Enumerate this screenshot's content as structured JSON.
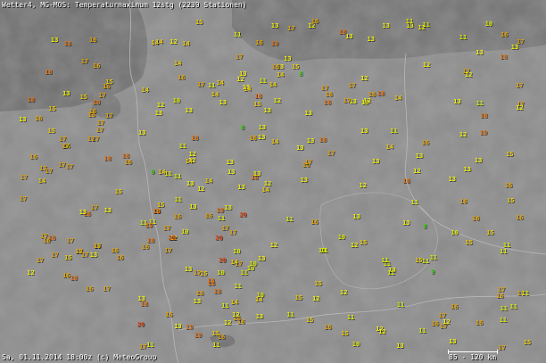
{
  "header": {
    "title": "Wetter4, MG-MOS: Temperaturmaximum 12stg (2239 Stationen)"
  },
  "footer": {
    "timestamp": "Sa, 01.11.2014 18:00z (c) MeteoGroup",
    "scale": "85 - 120 km"
  },
  "colors": {
    "background": "#818181",
    "land": "#8c8c8c",
    "sea": "#6f6f6f",
    "border": "#b8b8b8",
    "temp_10_11": "#d8e800",
    "temp_12_13": "#f0f000",
    "temp_14_15": "#e8c800",
    "temp_16_17": "#e0a000",
    "temp_18_19": "#e07010",
    "temp_20_plus": "#d84818",
    "cool_8_9": "#40d020"
  },
  "stations": [
    {
      "v": "16"
    },
    {
      "v": "16"
    },
    {
      "v": "17"
    },
    {
      "v": "17"
    },
    {
      "v": "15"
    },
    {
      "v": "17"
    },
    {
      "v": "16"
    },
    {
      "v": "15"
    },
    {
      "v": "17"
    },
    {
      "v": "16"
    },
    {
      "v": "16"
    },
    {
      "v": "17"
    },
    {
      "v": "15"
    },
    {
      "v": "16"
    },
    {
      "v": "14"
    },
    {
      "v": "15"
    },
    {
      "v": "16"
    },
    {
      "v": "17"
    },
    {
      "v": "18"
    },
    {
      "v": "17"
    },
    {
      "v": "15"
    },
    {
      "v": "17"
    },
    {
      "v": "15"
    },
    {
      "v": "16"
    },
    {
      "v": "17"
    },
    {
      "v": "17"
    },
    {
      "v": "18"
    },
    {
      "v": "17"
    },
    {
      "v": "16"
    },
    {
      "v": "18"
    },
    {
      "v": "18"
    },
    {
      "v": "16"
    },
    {
      "v": "15"
    },
    {
      "v": "13"
    },
    {
      "v": "18"
    },
    {
      "v": "17"
    },
    {
      "v": "18"
    },
    {
      "v": "17"
    },
    {
      "v": "17"
    },
    {
      "v": "16"
    },
    {
      "v": "18"
    },
    {
      "v": "17"
    },
    {
      "v": "15"
    },
    {
      "v": "17"
    },
    {
      "v": "17"
    },
    {
      "v": "13"
    },
    {
      "v": "18"
    },
    {
      "v": "16"
    },
    {
      "v": "14"
    },
    {
      "v": "13"
    },
    {
      "v": "13"
    },
    {
      "v": "12"
    },
    {
      "v": "18"
    },
    {
      "v": "17"
    },
    {
      "v": "17"
    },
    {
      "v": "16"
    },
    {
      "v": "17"
    },
    {
      "v": "13"
    },
    {
      "v": "17"
    },
    {
      "v": "17"
    },
    {
      "v": "17"
    },
    {
      "v": "13"
    },
    {
      "v": "17"
    },
    {
      "v": "16"
    },
    {
      "v": "15"
    },
    {
      "v": "18"
    },
    {
      "v": "16"
    },
    {
      "v": "17"
    },
    {
      "v": "18"
    },
    {
      "v": "18"
    },
    {
      "v": "17"
    },
    {
      "v": "16"
    },
    {
      "v": "13"
    },
    {
      "v": "13"
    },
    {
      "v": "13"
    },
    {
      "v": "14"
    },
    {
      "v": "13"
    },
    {
      "v": "14"
    },
    {
      "v": "15"
    },
    {
      "v": "13"
    },
    {
      "v": "14"
    },
    {
      "v": "14"
    },
    {
      "v": "14"
    },
    {
      "v": "11"
    },
    {
      "v": "10"
    },
    {
      "v": "8"
    },
    {
      "v": "9"
    },
    {
      "v": "12"
    },
    {
      "v": "14"
    },
    {
      "v": "13"
    },
    {
      "v": "11"
    },
    {
      "v": "12"
    },
    {
      "v": "13"
    },
    {
      "v": "13"
    },
    {
      "v": "13"
    },
    {
      "v": "14"
    },
    {
      "v": "13"
    },
    {
      "v": "12"
    },
    {
      "v": "14"
    },
    {
      "v": "13"
    },
    {
      "v": "12"
    },
    {
      "v": "14"
    },
    {
      "v": "13"
    },
    {
      "v": "13"
    },
    {
      "v": "14"
    },
    {
      "v": "15"
    },
    {
      "v": "14"
    },
    {
      "v": "14"
    },
    {
      "v": "12"
    },
    {
      "v": "11"
    },
    {
      "v": "11"
    },
    {
      "v": "13"
    },
    {
      "v": "14"
    },
    {
      "v": "12"
    },
    {
      "v": "13"
    },
    {
      "v": "12"
    },
    {
      "v": "8"
    },
    {
      "v": "11"
    },
    {
      "v": "13"
    },
    {
      "v": "13"
    },
    {
      "v": "14"
    },
    {
      "v": "12"
    },
    {
      "v": "13"
    },
    {
      "v": "12"
    },
    {
      "v": "11"
    },
    {
      "v": "13"
    },
    {
      "v": "13"
    },
    {
      "v": "14"
    },
    {
      "v": "17"
    },
    {
      "v": "16"
    },
    {
      "v": "17"
    },
    {
      "v": "16"
    },
    {
      "v": "17"
    },
    {
      "v": "17"
    },
    {
      "v": "16"
    },
    {
      "v": "15"
    },
    {
      "v": "15"
    },
    {
      "v": "16"
    },
    {
      "v": "16"
    },
    {
      "v": "16"
    },
    {
      "v": "17"
    },
    {
      "v": "18"
    },
    {
      "v": "16"
    },
    {
      "v": "18"
    },
    {
      "v": "14"
    },
    {
      "v": "17"
    },
    {
      "v": "16"
    },
    {
      "v": "17"
    },
    {
      "v": "16"
    },
    {
      "v": "13"
    },
    {
      "v": "14"
    },
    {
      "v": "13"
    },
    {
      "v": "15"
    },
    {
      "v": "11"
    },
    {
      "v": "12"
    },
    {
      "v": "11"
    },
    {
      "v": "11"
    },
    {
      "v": "11"
    },
    {
      "v": "11"
    },
    {
      "v": "11"
    },
    {
      "v": "13"
    },
    {
      "v": "12"
    },
    {
      "v": "10"
    },
    {
      "v": "11"
    },
    {
      "v": "10"
    },
    {
      "v": "10"
    },
    {
      "v": "10"
    },
    {
      "v": "13"
    },
    {
      "v": "11"
    },
    {
      "v": "13"
    },
    {
      "v": "13"
    },
    {
      "v": "10"
    },
    {
      "v": "11"
    },
    {
      "v": "12"
    },
    {
      "v": "10"
    },
    {
      "v": "13"
    },
    {
      "v": "20"
    },
    {
      "v": "19"
    },
    {
      "v": "20"
    },
    {
      "v": "19"
    },
    {
      "v": "18"
    },
    {
      "v": "19"
    },
    {
      "v": "20"
    },
    {
      "v": "19"
    },
    {
      "v": "18"
    },
    {
      "v": "20"
    },
    {
      "v": "19"
    },
    {
      "v": "18"
    },
    {
      "v": "20"
    },
    {
      "v": "19"
    },
    {
      "v": "18"
    },
    {
      "v": "19"
    },
    {
      "v": "18"
    },
    {
      "v": "17"
    },
    {
      "v": "16"
    },
    {
      "v": "17"
    },
    {
      "v": "18"
    },
    {
      "v": "17"
    },
    {
      "v": "16"
    },
    {
      "v": "18"
    },
    {
      "v": "13"
    },
    {
      "v": "13"
    },
    {
      "v": "15"
    },
    {
      "v": "12"
    },
    {
      "v": "13"
    },
    {
      "v": "13"
    },
    {
      "v": "14"
    },
    {
      "v": "11"
    },
    {
      "v": "13"
    },
    {
      "v": "12"
    },
    {
      "v": "13"
    },
    {
      "v": "12"
    },
    {
      "v": "13"
    },
    {
      "v": "13"
    },
    {
      "v": "11"
    },
    {
      "v": "13"
    },
    {
      "v": "17"
    },
    {
      "v": "16"
    },
    {
      "v": "18"
    },
    {
      "v": "16"
    },
    {
      "v": "17"
    },
    {
      "v": "16"
    },
    {
      "v": "17"
    },
    {
      "v": "16"
    },
    {
      "v": "18"
    },
    {
      "v": "17"
    },
    {
      "v": "16"
    },
    {
      "v": "17"
    },
    {
      "v": "18"
    },
    {
      "v": "17"
    },
    {
      "v": "16"
    },
    {
      "v": "17"
    },
    {
      "v": "13"
    },
    {
      "v": "12"
    },
    {
      "v": "13"
    },
    {
      "v": "12"
    },
    {
      "v": "11"
    },
    {
      "v": "12"
    },
    {
      "v": "13"
    },
    {
      "v": "12"
    },
    {
      "v": "13"
    },
    {
      "v": "14"
    },
    {
      "v": "12"
    },
    {
      "v": "13"
    },
    {
      "v": "14"
    },
    {
      "v": "13"
    },
    {
      "v": "12"
    },
    {
      "v": "13"
    },
    {
      "v": "11"
    },
    {
      "v": "10"
    },
    {
      "v": "11"
    },
    {
      "v": "12"
    },
    {
      "v": "11"
    },
    {
      "v": "10"
    },
    {
      "v": "11"
    },
    {
      "v": "12"
    },
    {
      "v": "11"
    },
    {
      "v": "11"
    },
    {
      "v": "11"
    },
    {
      "v": "11"
    },
    {
      "v": "8"
    },
    {
      "v": "9"
    },
    {
      "v": "11"
    },
    {
      "v": "12"
    },
    {
      "v": "15"
    },
    {
      "v": "15"
    },
    {
      "v": "16"
    },
    {
      "v": "16"
    },
    {
      "v": "15"
    },
    {
      "v": "15"
    },
    {
      "v": "16"
    },
    {
      "v": "15"
    },
    {
      "v": "17"
    },
    {
      "v": "16"
    },
    {
      "v": "15"
    },
    {
      "v": "17"
    },
    {
      "v": "16"
    },
    {
      "v": "17"
    },
    {
      "v": "15"
    },
    {
      "v": "16"
    },
    {
      "v": "10"
    },
    {
      "v": "11"
    },
    {
      "v": "10"
    },
    {
      "v": "12"
    },
    {
      "v": "11"
    },
    {
      "v": "11"
    },
    {
      "v": "10"
    },
    {
      "v": "11"
    },
    {
      "v": "13"
    },
    {
      "v": "12"
    },
    {
      "v": "11"
    },
    {
      "v": "12"
    },
    {
      "v": "13"
    },
    {
      "v": "11"
    },
    {
      "v": "12"
    },
    {
      "v": "13"
    },
    {
      "v": "15"
    },
    {
      "v": "15"
    },
    {
      "v": "16"
    },
    {
      "v": "17"
    },
    {
      "v": "16"
    },
    {
      "v": "15"
    },
    {
      "v": "17"
    },
    {
      "v": "16"
    },
    {
      "v": "11"
    },
    {
      "v": "13"
    },
    {
      "v": "11"
    },
    {
      "v": "12"
    },
    {
      "v": "11"
    },
    {
      "v": "13"
    },
    {
      "v": "11"
    },
    {
      "v": "11"
    }
  ]
}
